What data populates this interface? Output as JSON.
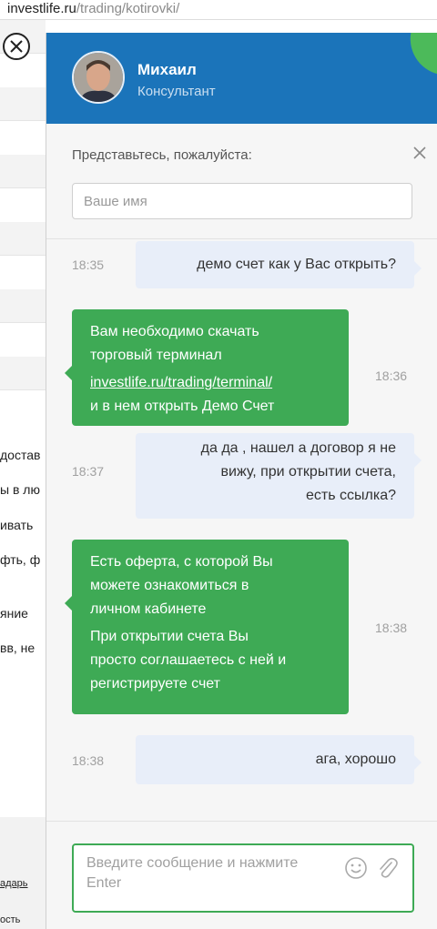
{
  "browser": {
    "url_domain": "investlife.ru",
    "url_path": "/trading/kotirovki/"
  },
  "background_page": {
    "fragments": [
      "дocтав",
      "ы в лю",
      "ивать",
      "фть, ф",
      "яние",
      "вв, не"
    ],
    "footer_link": "адарь",
    "footer_text": "ость"
  },
  "chat": {
    "agent_name": "Михаил",
    "agent_role": "Консультант",
    "intro_label": "Представьтесь, пожалуйста:",
    "name_placeholder": "Ваше имя",
    "messages": [
      {
        "from": "user",
        "time": "18:35",
        "lines": [
          "демо счет как у Вас открыть?"
        ]
      },
      {
        "from": "agent",
        "time": "18:36",
        "lines": [
          "Вам необходимо скачать",
          "торговый терминал"
        ],
        "link": "investlife.ru/trading/terminal/",
        "after": "и в нем открыть Демо Счет"
      },
      {
        "from": "user",
        "time": "18:37",
        "lines": [
          "да да , нашел а договор я не",
          "вижу, при открытии счета,",
          "есть ссылка?"
        ]
      },
      {
        "from": "agent",
        "time": "18:38",
        "lines": [
          "Есть оферта, с которой Вы",
          "можете ознакомиться в",
          "личном кабинете",
          "При открытии счета Вы",
          "просто соглашаетесь с ней и",
          "регистрируете счет"
        ]
      },
      {
        "from": "user",
        "time": "18:38",
        "lines": [
          "ага, хорошо"
        ]
      }
    ],
    "input_placeholder_line1": "Введите сообщение и нажмите",
    "input_placeholder_line2": "Enter",
    "icons": {
      "smile": "smile-icon",
      "attach": "paperclip-icon",
      "close": "close-icon"
    },
    "colors": {
      "header": "#1b74ba",
      "agent_bubble": "#3eaa55",
      "user_bubble": "#e8eef9"
    }
  }
}
